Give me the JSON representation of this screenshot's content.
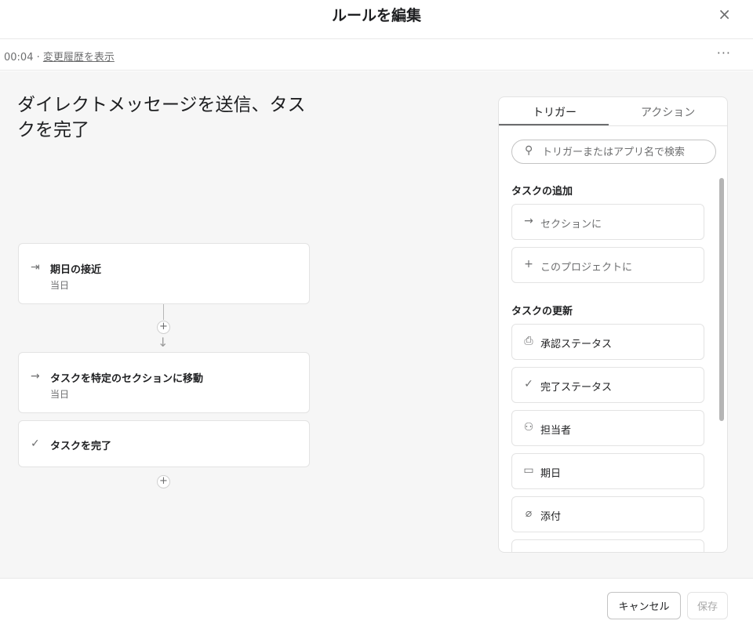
{
  "header": {
    "title": "ルールを編集",
    "close_icon": "×"
  },
  "subbar": {
    "time": "00:04 · ",
    "history_link": "変更履歴を表示",
    "more_icon": "···"
  },
  "rule": {
    "name": "ダイレクトメッセージを送信、タスクを完了",
    "steps": [
      {
        "icon": "⇥",
        "title": "期日の接近",
        "sub": "当日"
      },
      {
        "icon": "→",
        "title": "タスクを特定のセクションに移動",
        "sub": "当日"
      },
      {
        "icon": "✓",
        "title": "タスクを完了",
        "sub": ""
      }
    ],
    "add_icon": "+",
    "arrow_down": "↓"
  },
  "panel": {
    "tabs": [
      "トリガー",
      "アクション"
    ],
    "active_tab": "トリガー",
    "search_placeholder": "トリガーまたはアプリ名で検索",
    "search_icon": "⚲",
    "sections": [
      {
        "label": "タスクの追加",
        "items": [
          {
            "icon": "→",
            "label": "セクションに"
          },
          {
            "icon": "+",
            "label": "このプロジェクトに"
          }
        ]
      },
      {
        "label": "タスクの更新",
        "items": [
          {
            "icon": "⎙",
            "label": "承認ステータス"
          },
          {
            "icon": "✓",
            "label": "完了ステータス"
          },
          {
            "icon": "⚇",
            "label": "担当者"
          },
          {
            "icon": "▭",
            "label": "期日"
          },
          {
            "icon": "⌀",
            "label": "添付"
          }
        ]
      }
    ]
  },
  "footer": {
    "cancel_label": "キャンセル",
    "save_label": "保存"
  }
}
